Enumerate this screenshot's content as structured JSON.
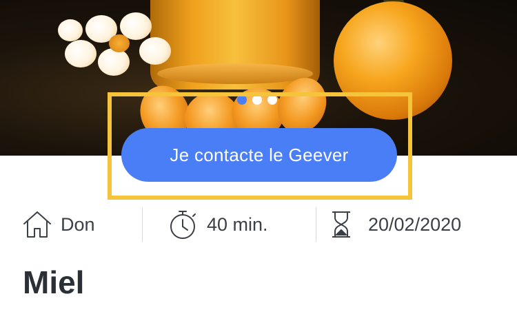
{
  "carousel": {
    "slide_count": 3,
    "active_index": 0,
    "colors": {
      "active": "#4a7ef6",
      "inactive": "#ffffff"
    }
  },
  "contact_button": {
    "label": "Je contacte le Geever",
    "color": "#4a7ef6"
  },
  "highlight_color": "#f6c43a",
  "info": {
    "type": {
      "icon": "house-icon",
      "label": "Don"
    },
    "duration": {
      "icon": "stopwatch-icon",
      "label": "40 min."
    },
    "date": {
      "icon": "hourglass-icon",
      "label": "20/02/2020"
    }
  },
  "item": {
    "title": "Miel"
  }
}
